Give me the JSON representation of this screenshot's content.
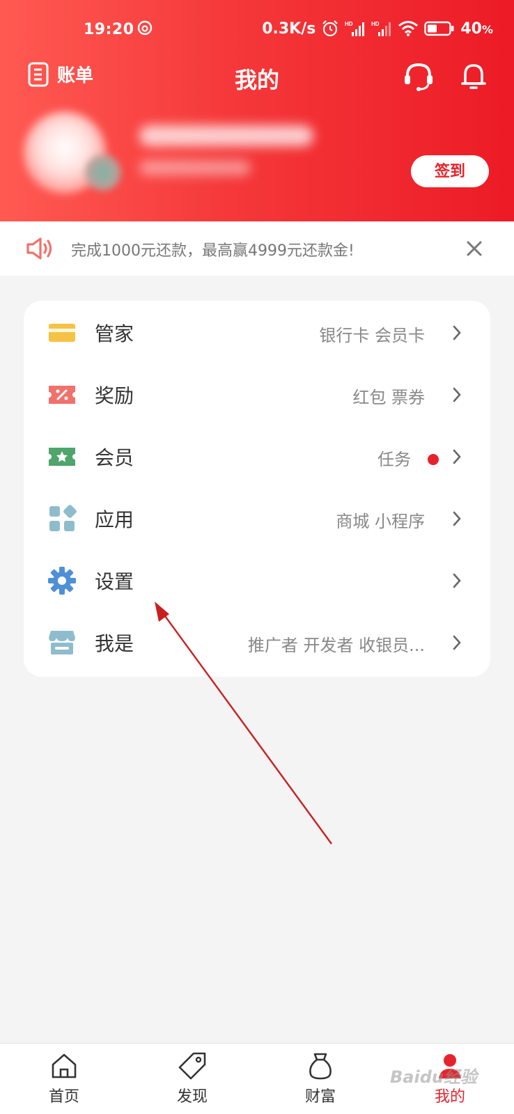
{
  "status_bar": {
    "time": "19:20",
    "network_speed": "0.3K/s",
    "battery": "40",
    "battery_unit": "%",
    "icons": [
      "netease-music-icon",
      "alarm-icon",
      "signal-hd-icon",
      "signal-hd-icon",
      "wifi-icon",
      "battery-icon"
    ]
  },
  "header": {
    "bill_label": "账单",
    "title": "我的",
    "signin_label": "签到"
  },
  "notice": {
    "text": "完成1000元还款，最高赢4999元还款金!"
  },
  "menu": [
    {
      "label": "管家",
      "desc": "银行卡 会员卡",
      "icon": "card-icon",
      "color": "#f6c244"
    },
    {
      "label": "奖励",
      "desc": "红包 票券",
      "icon": "coupon-icon",
      "color": "#f0726a"
    },
    {
      "label": "会员",
      "desc": "任务",
      "icon": "member-ticket-icon",
      "color": "#4fa56b",
      "badge": true
    },
    {
      "label": "应用",
      "desc": "商城 小程序",
      "icon": "apps-icon",
      "color": "#8fbccc"
    },
    {
      "label": "设置",
      "desc": "",
      "icon": "gear-icon",
      "color": "#4f8fd6"
    },
    {
      "label": "我是",
      "desc": "推广者 开发者 收银员...",
      "icon": "store-icon",
      "color": "#8fbccc"
    }
  ],
  "tabs": [
    {
      "label": "首页",
      "icon": "home-icon"
    },
    {
      "label": "发现",
      "icon": "tag-icon"
    },
    {
      "label": "财富",
      "icon": "money-bag-icon"
    },
    {
      "label": "我的",
      "icon": "user-icon",
      "active": true
    }
  ],
  "colors": {
    "brand_red": "#e8222c",
    "header_gradient_start": "#ff5a52",
    "header_gradient_end": "#ec1b26",
    "page_bg": "#f4f4f4"
  },
  "watermark": "Baidu经验"
}
